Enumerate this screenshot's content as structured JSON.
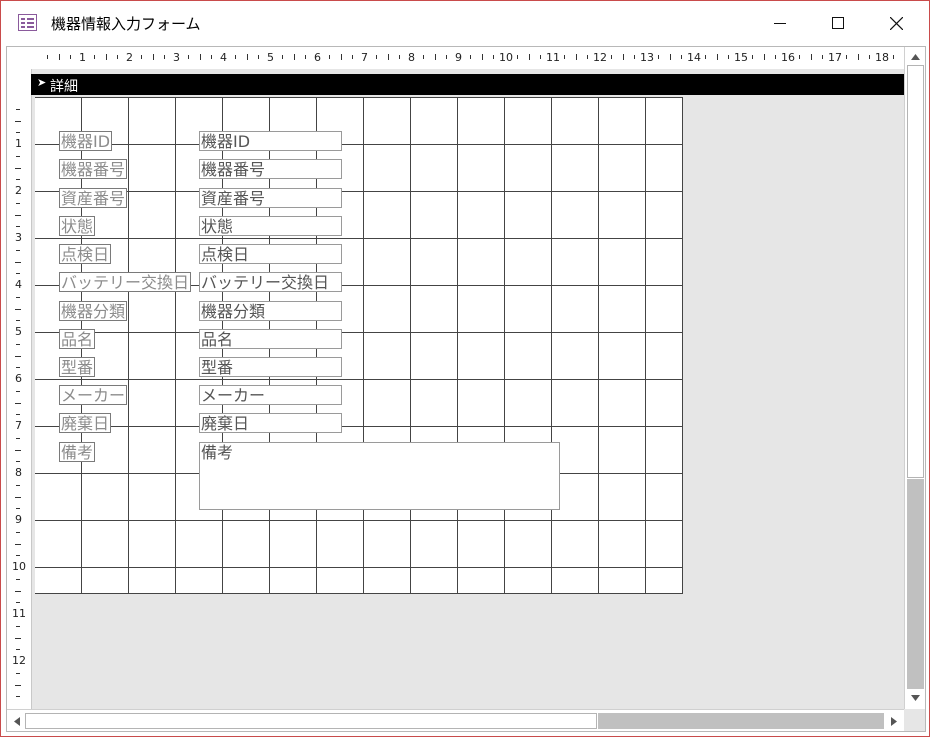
{
  "window": {
    "title": "機器情報入力フォーム"
  },
  "section": {
    "title": "詳細"
  },
  "ruler": {
    "horizontal": [
      "1",
      "2",
      "3",
      "4",
      "5",
      "6",
      "7",
      "8",
      "9",
      "10",
      "11",
      "12",
      "13",
      "14",
      "15",
      "16",
      "17",
      "18"
    ],
    "vertical": [
      "1",
      "2",
      "3",
      "4",
      "5",
      "6",
      "7",
      "8",
      "9",
      "10",
      "11",
      "12"
    ]
  },
  "fields": [
    {
      "label": "機器ID",
      "control": "機器ID"
    },
    {
      "label": "機器番号",
      "control": "機器番号"
    },
    {
      "label": "資産番号",
      "control": "資産番号"
    },
    {
      "label": "状態",
      "control": "状態"
    },
    {
      "label": "点検日",
      "control": "点検日"
    },
    {
      "label": "バッテリー交換日",
      "control": "バッテリー交換日"
    },
    {
      "label": "機器分類",
      "control": "機器分類"
    },
    {
      "label": "品名",
      "control": "品名"
    },
    {
      "label": "型番",
      "control": "型番"
    },
    {
      "label": "メーカー",
      "control": "メーカー"
    },
    {
      "label": "廃棄日",
      "control": "廃棄日"
    },
    {
      "label": "備考",
      "control": "備考"
    }
  ],
  "icons": {
    "app": "form-icon",
    "minimize": "minimize-icon",
    "maximize": "maximize-icon",
    "close": "close-icon",
    "section": "section-selector-icon"
  }
}
